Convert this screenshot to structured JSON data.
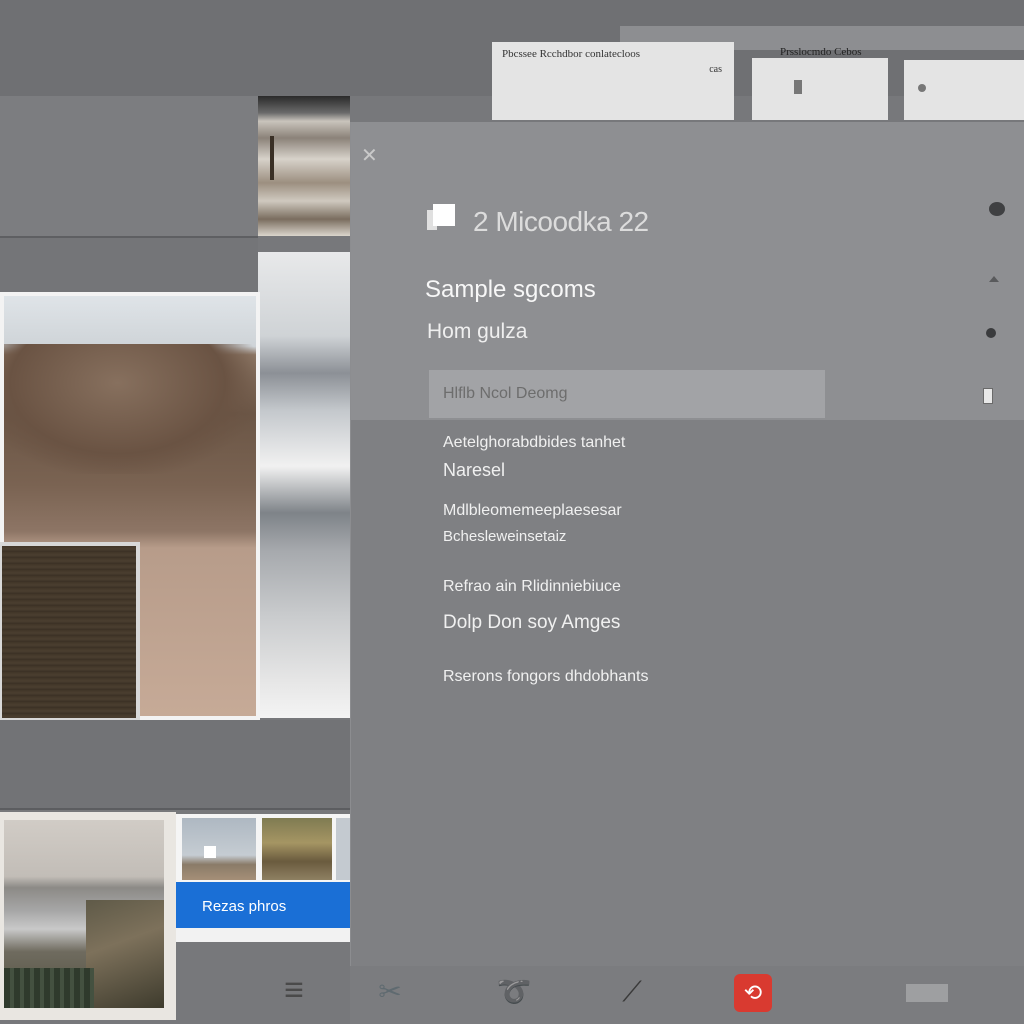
{
  "window": {
    "tabs": [
      {
        "label": "Pbcssee Rcchdbor conlatecloos",
        "extra": "cas"
      },
      {
        "label": ""
      },
      {
        "label": ""
      }
    ],
    "strip_title": "Prsslocmdo Cebos"
  },
  "left_panel": {
    "resize_button": "Rezas phros"
  },
  "dialog": {
    "app_title": "2 Micoodka 22",
    "section_title": "Sample sgcoms",
    "section_sub": "Hom gulza",
    "search": {
      "value": "",
      "placeholder": "Hlflb Ncol Deomg"
    },
    "texts": [
      "Aetelghorabdbides tanhet",
      "Naresel",
      "Mdlbleomemeeplaesesar",
      "Bchesleweinsetaiz",
      "Refrao ain Rlidinniebiuce",
      "Dolp Don soy Amges",
      "Rserons fongors dhdobhants"
    ]
  },
  "toolbar": {
    "icons": [
      "scissors-icon",
      "lasso-icon",
      "brush-icon",
      "adobe-icon",
      "panel-toggle-icon"
    ]
  },
  "colors": {
    "accent": "#1a6fd6",
    "panel": "#7f8083",
    "panel_top": "#8e8f92",
    "adobe_red": "#d93a30"
  }
}
